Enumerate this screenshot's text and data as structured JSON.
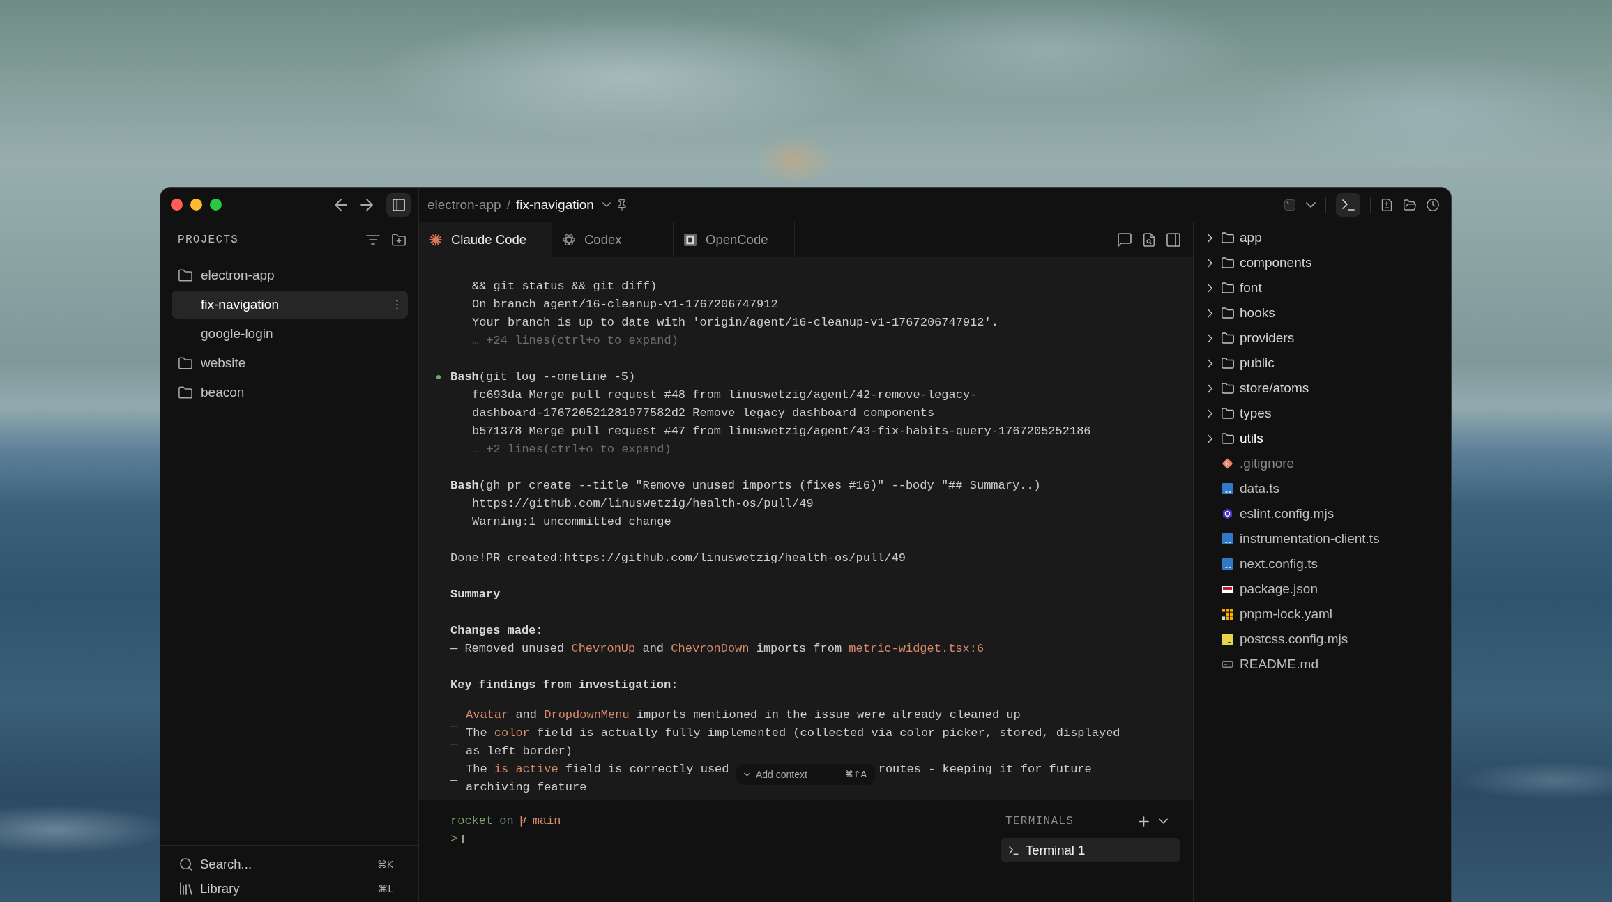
{
  "window_controls": [
    {
      "color": "#ff5f57"
    },
    {
      "color": "#febc2e"
    },
    {
      "color": "#28c840"
    }
  ],
  "titlebar": {
    "nav": [
      {
        "kind": "back",
        "on": false
      },
      {
        "kind": "forward",
        "on": false
      },
      {
        "kind": "sidebar",
        "on": true
      }
    ],
    "breadcrumb": {
      "project": "electron-app",
      "separator": "/",
      "current": "fix-navigation"
    },
    "breadcrumb_actions": [
      {
        "kind": "dropdown"
      },
      {
        "kind": "pin"
      }
    ],
    "tool_groups": [
      [
        {
          "kind": "window",
          "on": false
        },
        {
          "kind": "dropdown",
          "on": false
        }
      ],
      [
        {
          "kind": "terminal",
          "on": true
        }
      ],
      [
        {
          "kind": "diff",
          "on": false
        },
        {
          "kind": "folder",
          "on": false
        },
        {
          "kind": "history",
          "on": false
        }
      ]
    ]
  },
  "sidebar": {
    "title": "PROJECTS",
    "actions": [
      {
        "kind": "filter"
      },
      {
        "kind": "new-folder"
      }
    ],
    "projects": [
      {
        "name": "electron-app",
        "selected": false,
        "children": [
          {
            "name": "fix-navigation",
            "selected": true
          },
          {
            "name": "google-login",
            "selected": false
          }
        ]
      },
      {
        "name": "website",
        "selected": false
      },
      {
        "name": "beacon",
        "selected": false
      }
    ],
    "footer": [
      {
        "kind": "search",
        "label": "Search...",
        "shortcut": "⌘K"
      },
      {
        "kind": "library",
        "label": "Library",
        "shortcut": "⌘L"
      }
    ]
  },
  "tabs": [
    {
      "kind": "claude",
      "label": "Claude Code",
      "selected": true
    },
    {
      "kind": "codex",
      "label": "Codex",
      "selected": false
    },
    {
      "kind": "opencode",
      "label": "OpenCode",
      "selected": false
    }
  ],
  "tab_actions": [
    {
      "kind": "comment"
    },
    {
      "kind": "file-search"
    },
    {
      "kind": "panel"
    }
  ],
  "transcript": [
    {
      "kind": "output",
      "lines": [
        "&& git status && git diff)",
        "On branch agent/16-cleanup-v1-1767206747912",
        "Your branch is up to date with 'origin/agent/16-cleanup-v1-1767206747912'."
      ],
      "more": "… +24 lines(ctrl+o to expand)"
    },
    {
      "kind": "tool",
      "bullet": true,
      "command": "**Bash**(git log --oneline -5)",
      "lines": [
        "fc693da Merge pull request #48 from linuswetzig/agent/42-remove-legacy-",
        "dashboard-176720521281977582d2 Remove legacy dashboard components",
        "b571378 Merge pull request #47 from linuswetzig/agent/43-fix-habits-query-1767205252186"
      ],
      "more": "… +2 lines(ctrl+o to expand)"
    },
    {
      "kind": "tool",
      "bullet": false,
      "command": "**Bash**(gh pr create --title \"Remove unused imports (fixes #16)\" --body \"## Summary..)",
      "lines": [
        "https://github.com/linuswetzig/health-os/pull/49",
        "Warning:1 uncommitted change"
      ]
    },
    {
      "kind": "text",
      "text": "Done!PR created:https://github.com/linuswetzig/health-os/pull/49"
    },
    {
      "kind": "heading",
      "text": "Summary"
    },
    {
      "kind": "section",
      "heading": "Changes made:",
      "lines": [
        {
          "segments": [
            {
              "kind": "text",
              "text": "— Removed unused "
            },
            {
              "kind": "code",
              "text": "ChevronUp"
            },
            {
              "kind": "text",
              "text": " and "
            },
            {
              "kind": "code",
              "text": "ChevronDown"
            },
            {
              "kind": "text",
              "text": " imports from "
            },
            {
              "kind": "code",
              "text": "metric-widget.tsx:6"
            }
          ]
        }
      ]
    },
    {
      "kind": "list",
      "heading": "Key findings from investigation:",
      "items": [
        {
          "marker": "—",
          "segments": [
            {
              "kind": "code",
              "text": "Avatar"
            },
            {
              "kind": "text",
              "text": " and "
            },
            {
              "kind": "code",
              "text": "DropdownMenu"
            },
            {
              "kind": "text",
              "text": " imports mentioned in the issue were already cleaned up"
            }
          ]
        },
        {
          "marker": "—",
          "segments": [
            {
              "kind": "text",
              "text": "The "
            },
            {
              "kind": "code",
              "text": "color"
            },
            {
              "kind": "text",
              "text": " field is actually fully implemented (collected via color picker, stored, displayed as left border)"
            }
          ]
        },
        {
          "marker": "—",
          "segments": [
            {
              "kind": "text",
              "text": "The "
            },
            {
              "kind": "code",
              "text": "is active"
            },
            {
              "kind": "text",
              "text": " field is correctly used"
            },
            {
              "kind": "covered"
            },
            {
              "kind": "text",
              "text": "routes - keeping it for future"
            },
            {
              "kind": "break"
            },
            {
              "kind": "text",
              "text": "archiving feature"
            }
          ]
        }
      ]
    }
  ],
  "context_popup": {
    "label": "Add context",
    "shortcut": "⌘⇧A"
  },
  "terminal": {
    "prompt": {
      "directory": "rocket",
      "connector": "on",
      "branch": "main",
      "symbol": ">"
    }
  },
  "terminals": {
    "title": "TERMINALS",
    "actions": [
      {
        "kind": "add"
      },
      {
        "kind": "collapse"
      }
    ],
    "items": [
      {
        "label": "Terminal 1",
        "selected": true
      }
    ]
  },
  "file_tree": [
    {
      "name": "app",
      "kind": "folder",
      "expanded": false,
      "selected": false,
      "ignored": false
    },
    {
      "name": "components",
      "kind": "folder",
      "expanded": false,
      "selected": false,
      "ignored": false
    },
    {
      "name": "font",
      "kind": "folder",
      "expanded": false,
      "selected": false,
      "ignored": false
    },
    {
      "name": "hooks",
      "kind": "folder",
      "expanded": false,
      "selected": false,
      "ignored": false
    },
    {
      "name": "providers",
      "kind": "folder",
      "expanded": false,
      "selected": false,
      "ignored": false
    },
    {
      "name": "public",
      "kind": "folder",
      "expanded": false,
      "selected": false,
      "ignored": false
    },
    {
      "name": "store/atoms",
      "kind": "folder",
      "expanded": false,
      "selected": false,
      "ignored": false
    },
    {
      "name": "types",
      "kind": "folder",
      "expanded": false,
      "selected": false,
      "ignored": false
    },
    {
      "name": "utils",
      "kind": "folder",
      "expanded": false,
      "selected": true,
      "ignored": false
    },
    {
      "name": ".gitignore",
      "kind": "gitignore",
      "selected": false,
      "ignored": true
    },
    {
      "name": "data.ts",
      "kind": "typescript",
      "selected": false,
      "ignored": false
    },
    {
      "name": "eslint.config.mjs",
      "kind": "eslint",
      "selected": false,
      "ignored": false
    },
    {
      "name": "instrumentation-client.ts",
      "kind": "typescript",
      "selected": false,
      "ignored": false
    },
    {
      "name": "next.config.ts",
      "kind": "typescript",
      "selected": false,
      "ignored": false
    },
    {
      "name": "package.json",
      "kind": "npm",
      "selected": false,
      "ignored": false
    },
    {
      "name": "pnpm-lock.yaml",
      "kind": "pnpm",
      "selected": false,
      "ignored": false
    },
    {
      "name": "postcss.config.mjs",
      "kind": "javascript",
      "selected": false,
      "ignored": false
    },
    {
      "name": "README.md",
      "kind": "markdown",
      "selected": false,
      "ignored": false
    }
  ]
}
